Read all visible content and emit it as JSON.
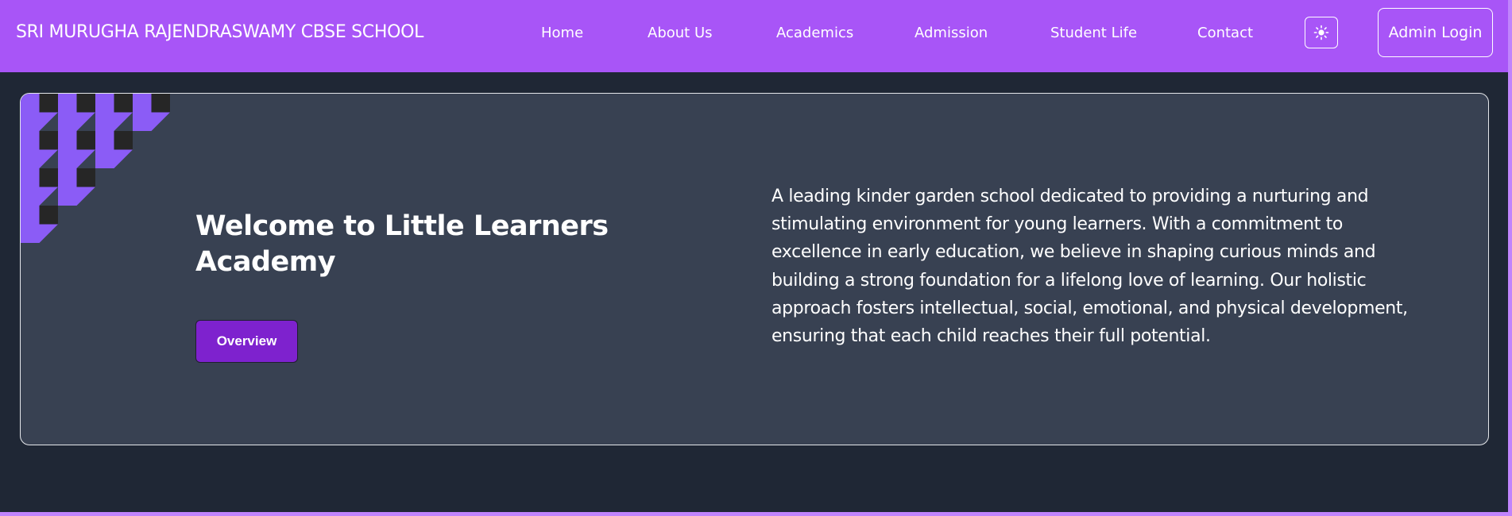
{
  "header": {
    "brand": "SRI MURUGHA RAJENDRASWAMY CBSE SCHOOL",
    "nav": {
      "home": "Home",
      "about": "About Us",
      "academics": "Academics",
      "admission": "Admission",
      "student_life": "Student Life",
      "contact": "Contact"
    },
    "theme_toggle_icon": "sun-icon",
    "admin_login": "Admin Login"
  },
  "hero": {
    "title": "Welcome to Little Learners Academy",
    "overview_button": "Overview",
    "description": "A leading kinder garden school dedicated to providing a nurturing and stimulating environment for young learners. With a commitment to excellence in early education, we believe in shaping curious minds and building a strong foundation for a lifelong love of learning. Our holistic approach fosters intellectual, social, emotional, and physical development, ensuring that each child reaches their full potential."
  },
  "colors": {
    "navbar": "#a855f7",
    "page_background": "#1f2735",
    "card_background": "#384152",
    "button": "#7e22ce",
    "pattern_purple": "#8b5cf6",
    "pattern_dark": "#262626"
  }
}
